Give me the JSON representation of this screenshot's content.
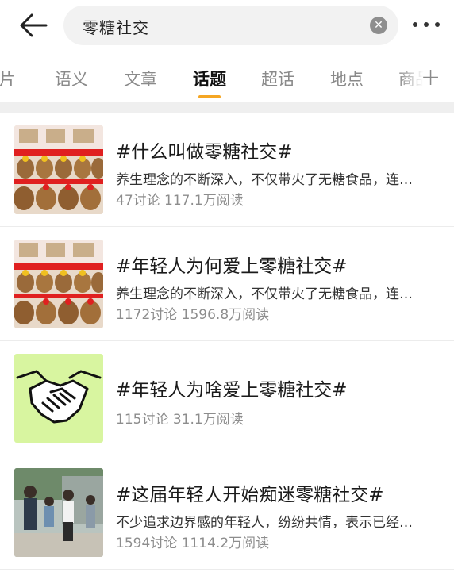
{
  "search": {
    "query": "零糖社交"
  },
  "tabs": [
    {
      "label": "图片"
    },
    {
      "label": "语义"
    },
    {
      "label": "文章"
    },
    {
      "label": "话题"
    },
    {
      "label": "超话"
    },
    {
      "label": "地点"
    },
    {
      "label": "商品"
    }
  ],
  "colors": {
    "accent": "#f5a623",
    "stats": "#8d8d8d",
    "thumb_green": "#d8f5a0"
  },
  "topics": [
    {
      "title": "#什么叫做零糖社交#",
      "desc": "养生理念的不断深入，不仅带火了无糖食品，连…",
      "stats": "47讨论 117.1万阅读",
      "thumb": "capybara-plush-display"
    },
    {
      "title": "#年轻人为何爱上零糖社交#",
      "desc": "养生理念的不断深入，不仅带火了无糖食品，连…",
      "stats": "1172讨论 1596.8万阅读",
      "thumb": "capybara-plush-display"
    },
    {
      "title": "#年轻人为啥爱上零糖社交#",
      "desc": "",
      "stats": "115讨论 31.1万阅读",
      "thumb": "handshake-icon"
    },
    {
      "title": "#这届年轻人开始痴迷零糖社交#",
      "desc": "不少追求边界感的年轻人，纷纷共情，表示已经…",
      "stats": "1594讨论 1114.2万阅读",
      "thumb": "young-people-photo"
    }
  ]
}
